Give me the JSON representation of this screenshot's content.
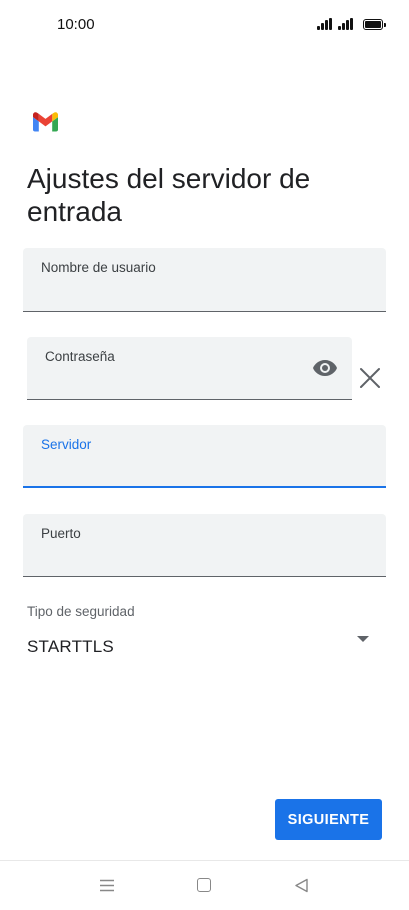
{
  "status_bar": {
    "time": "10:00"
  },
  "header": {
    "logo_icon": "gmail-logo-icon",
    "title": "Ajustes del servidor de entrada"
  },
  "form": {
    "username": {
      "label": "Nombre de usuario",
      "value": ""
    },
    "password": {
      "label": "Contraseña",
      "value": "",
      "toggle_icon": "eye-icon",
      "clear_icon": "close-icon"
    },
    "server": {
      "label": "Servidor",
      "value": "",
      "focused": true
    },
    "port": {
      "label": "Puerto",
      "value": ""
    },
    "security": {
      "label": "Tipo de seguridad",
      "selected": "STARTTLS",
      "icon": "dropdown-arrow-icon"
    }
  },
  "actions": {
    "next_label": "SIGUIENTE"
  },
  "colors": {
    "accent": "#1a73e8",
    "field_background": "#f1f3f4"
  },
  "nav_bar": {
    "menu_icon": "menu-icon",
    "home_icon": "home-icon",
    "back_icon": "back-icon"
  }
}
